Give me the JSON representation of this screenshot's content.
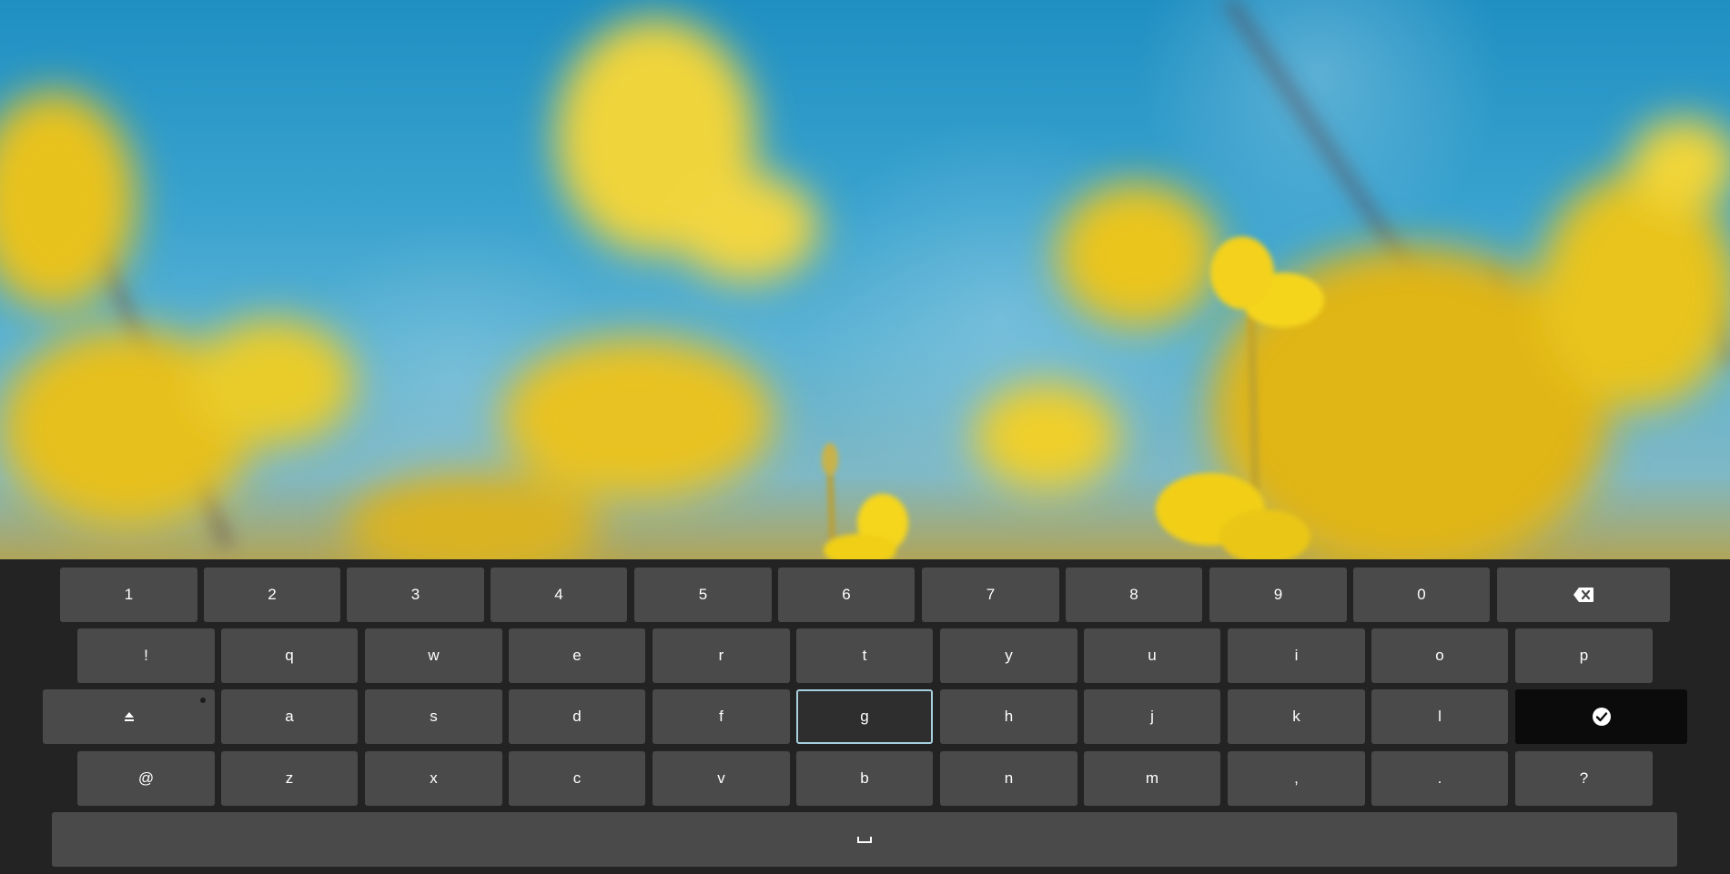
{
  "wallpaper": {
    "description_icon": "flower-wallpaper",
    "colors": {
      "sky": "#2a9acb",
      "flower": "#f2d020"
    }
  },
  "keyboard": {
    "colors": {
      "background": "#232323",
      "key": "#4a4a4a",
      "key_focused": "#2e2e2e",
      "focus_border": "#a7d0de",
      "enter": "#0b0b0b",
      "text": "#ffffff"
    },
    "row1": [
      "1",
      "2",
      "3",
      "4",
      "5",
      "6",
      "7",
      "8",
      "9",
      "0"
    ],
    "row2": [
      "!",
      "q",
      "w",
      "e",
      "r",
      "t",
      "y",
      "u",
      "i",
      "o",
      "p"
    ],
    "row3": [
      "a",
      "s",
      "d",
      "f",
      "g",
      "h",
      "j",
      "k",
      "l"
    ],
    "row4": [
      "@",
      "z",
      "x",
      "c",
      "v",
      "b",
      "n",
      "m",
      ",",
      ".",
      "?"
    ],
    "backspace_icon": "backspace-icon",
    "shift_icon": "shift-icon",
    "enter_icon": "checkmark-circle-icon",
    "space_icon": "space-bar-icon",
    "focused_key": "g"
  }
}
